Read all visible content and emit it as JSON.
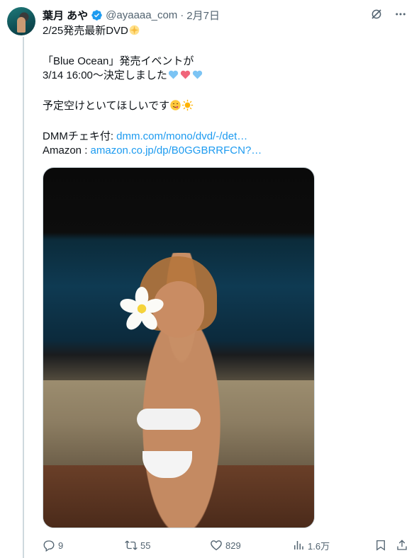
{
  "tweet": {
    "name": "葉月 あや",
    "handle": "@ayaaaa_com",
    "separator": "·",
    "time": "2月7日",
    "lines": {
      "l1": "2/25発売最新DVD",
      "l2": "「Blue Ocean」発売イベントが",
      "l3": "3/14 16:00～決定しました",
      "l4": "予定空けといてほしいです",
      "l5_label": "DMMチェキ付: ",
      "l5_link": "dmm.com/mono/dvd/-/det…",
      "l6_label": "Amazon : ",
      "l6_link": "amazon.co.jp/dp/B0GGBRRFCN?…"
    }
  },
  "actions": {
    "replies": "9",
    "retweets": "55",
    "likes": "829",
    "views": "1.6万"
  },
  "colors": {
    "text": "#0f1419",
    "muted": "#536471",
    "link": "#1d9bf0",
    "verified": "#1d9bf0",
    "heart_blue": "#7cc4f4",
    "heart_pink": "#f0657a"
  },
  "icons": [
    "avatar",
    "verified-badge-icon",
    "grok-icon",
    "more-icon",
    "sparkle-emoji",
    "blue-heart-icon",
    "pink-heart-icon",
    "yum-face-emoji",
    "sun-emoji",
    "reply-icon",
    "retweet-icon",
    "like-icon",
    "views-icon",
    "bookmark-icon",
    "share-icon"
  ]
}
